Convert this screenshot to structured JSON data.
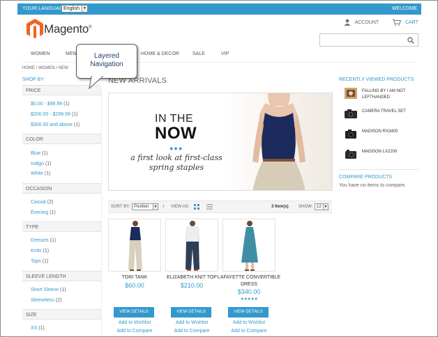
{
  "topbar": {
    "language_label": "YOUR LANGUAGE:",
    "language_value": "English",
    "welcome": "WELCOME"
  },
  "header": {
    "logo_text": "Magento",
    "logo_mark": "®",
    "account_label": "ACCOUNT",
    "cart_label": "CART"
  },
  "search": {
    "placeholder": ""
  },
  "nav": {
    "items": [
      {
        "label": "WOMEN"
      },
      {
        "label": "MEN"
      },
      {
        "label": "HOME & DECOR"
      },
      {
        "label": "SALE"
      },
      {
        "label": "VIP"
      }
    ]
  },
  "breadcrumb": {
    "text": "HOME  /  WOMEN  /  NEW"
  },
  "callout": {
    "line1": "Layered",
    "line2": "Navigation"
  },
  "sidebar": {
    "title": "SHOP BY",
    "groups": [
      {
        "label": "PRICE",
        "items": [
          {
            "label": "$0.00 - $99.99",
            "count": "(1)"
          },
          {
            "label": "$200.00 - $299.99",
            "count": "(1)"
          },
          {
            "label": "$300.00 and above",
            "count": "(1)"
          }
        ]
      },
      {
        "label": "COLOR",
        "items": [
          {
            "label": "Blue",
            "count": "(1)"
          },
          {
            "label": "Indigo",
            "count": "(1)"
          },
          {
            "label": "White",
            "count": "(1)"
          }
        ]
      },
      {
        "label": "OCCASION",
        "items": [
          {
            "label": "Casual",
            "count": "(2)"
          },
          {
            "label": "Evening",
            "count": "(1)"
          }
        ]
      },
      {
        "label": "TYPE",
        "items": [
          {
            "label": "Dresses",
            "count": "(1)"
          },
          {
            "label": "Knits",
            "count": "(1)"
          },
          {
            "label": "Tops",
            "count": "(1)"
          }
        ]
      },
      {
        "label": "SLEEVE LENGTH",
        "items": [
          {
            "label": "Short Sleeve",
            "count": "(1)"
          },
          {
            "label": "Sleeveless",
            "count": "(2)"
          }
        ]
      },
      {
        "label": "SIZE",
        "items": [
          {
            "label": "XS",
            "count": "(1)"
          }
        ]
      }
    ]
  },
  "main": {
    "title": "NEW ARRIVALS",
    "hero": {
      "line1": "IN THE",
      "line2": "NOW",
      "dots": "●●●",
      "sub1": "a first look at first-class",
      "sub2": "spring staples"
    },
    "toolbar": {
      "sort_label": "SORT BY:",
      "sort_value": "Position",
      "view_label": "VIEW AS:",
      "item_count": "3 Item(s)",
      "show_label": "SHOW:",
      "show_value": "12"
    },
    "products": [
      {
        "name": "TORI TANK",
        "price": "$60.00",
        "rating": "",
        "button": "VIEW DETAILS",
        "wishlist": "Add to Wishlist",
        "compare": "Add to Compare"
      },
      {
        "name": "ELIZABETH KNIT TOP",
        "price": "$210.00",
        "rating": "",
        "button": "VIEW DETAILS",
        "wishlist": "Add to Wishlist",
        "compare": "Add to Compare"
      },
      {
        "name": "LAFAYETTE CONVERTIBLE DRESS",
        "price": "$340.00",
        "rating": "★★★★★",
        "button": "VIEW DETAILS",
        "wishlist": "Add to Wishlist",
        "compare": "Add to Compare"
      }
    ]
  },
  "right": {
    "recent_title": "RECENTLY VIEWED PRODUCTS",
    "recent_items": [
      {
        "name": "FALLING BY I AM NOT LEFTHANDED"
      },
      {
        "name": "CAMERA TRAVEL SET"
      },
      {
        "name": "MADISON RX3400"
      },
      {
        "name": "MADISON LX2200"
      }
    ],
    "compare_title": "COMPARE PRODUCTS",
    "compare_text": "You have no items to compare."
  },
  "colors": {
    "accent": "#3399cc",
    "text": "#636363",
    "logo_orange": "#f26322"
  },
  "icons": [
    "language-dropdown-arrow",
    "account-icon",
    "cart-icon",
    "search-icon",
    "grid-view-icon",
    "list-view-icon",
    "sort-direction-icon",
    "logo-icon"
  ]
}
